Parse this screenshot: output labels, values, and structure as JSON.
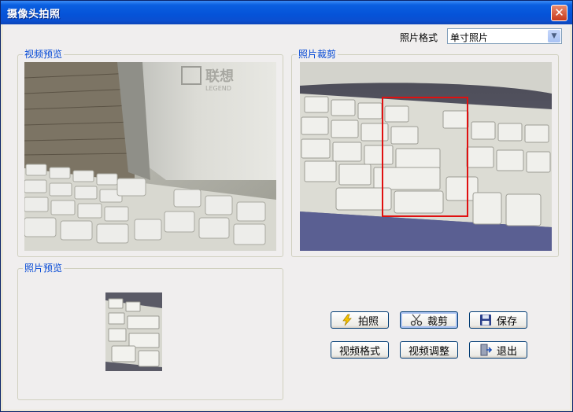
{
  "window": {
    "title": "摄像头拍照",
    "close_glyph": "✕"
  },
  "photo_format": {
    "label": "照片格式",
    "selected": "单寸照片"
  },
  "groups": {
    "video_preview": "视频预览",
    "photo_crop": "照片裁剪",
    "photo_preview": "照片预览"
  },
  "buttons": {
    "capture": "拍照",
    "crop": "裁剪",
    "save": "保存",
    "video_format": "视频格式",
    "video_adjust": "视频调整",
    "exit": "退出"
  },
  "icons": {
    "capture": "lightning-icon",
    "crop": "scissors-icon",
    "save": "floppy-disk-icon",
    "exit": "exit-door-icon",
    "close": "close-icon",
    "dropdown": "chevron-down-icon"
  },
  "preview_logo": {
    "chinese": "联想",
    "english": "LEGEND"
  },
  "colors": {
    "title_bar": "#0553d8",
    "group_label": "#0046d5",
    "crop_box": "#e01010",
    "button_border": "#003c74"
  }
}
